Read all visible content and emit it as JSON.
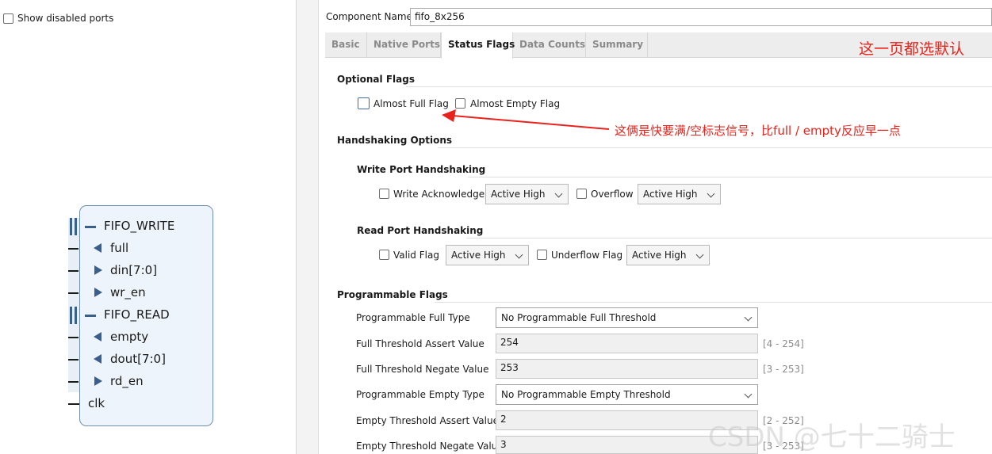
{
  "left": {
    "show_disabled_ports": "Show disabled ports"
  },
  "symbol": {
    "fifo_write": "FIFO_WRITE",
    "full": "full",
    "din": "din[7:0]",
    "wr_en": "wr_en",
    "fifo_read": "FIFO_READ",
    "empty": "empty",
    "dout": "dout[7:0]",
    "rd_en": "rd_en",
    "clk": "clk"
  },
  "header": {
    "component_name_label": "Component Name",
    "component_name_value": "fifo_8x256"
  },
  "tabs": [
    "Basic",
    "Native Ports",
    "Status Flags",
    "Data Counts",
    "Summary"
  ],
  "active_tab": "Status Flags",
  "annotations": {
    "page_note": "这一页都选默认",
    "arrow_note": "这俩是快要满/空标志信号，比full / empty反应早一点"
  },
  "optional_flags": {
    "title": "Optional Flags",
    "almost_full": "Almost Full Flag",
    "almost_empty": "Almost Empty Flag"
  },
  "handshaking": {
    "title": "Handshaking Options",
    "write_title": "Write Port Handshaking",
    "write_ack": "Write Acknowledge",
    "write_ack_sel": "Active High",
    "overflow": "Overflow",
    "overflow_sel": "Active High",
    "read_title": "Read Port Handshaking",
    "valid": "Valid Flag",
    "valid_sel": "Active High",
    "underflow": "Underflow Flag",
    "underflow_sel": "Active High"
  },
  "programmable": {
    "title": "Programmable Flags",
    "full_type_label": "Programmable Full Type",
    "full_type_value": "No Programmable Full Threshold",
    "full_assert_label": "Full Threshold Assert Value",
    "full_assert_value": "254",
    "full_assert_range": "[4 - 254]",
    "full_negate_label": "Full Threshold Negate Value",
    "full_negate_value": "253",
    "full_negate_range": "[3 - 253]",
    "empty_type_label": "Programmable Empty Type",
    "empty_type_value": "No Programmable Empty Threshold",
    "empty_assert_label": "Empty Threshold Assert Value",
    "empty_assert_value": "2",
    "empty_assert_range": "[2 - 252]",
    "empty_negate_label": "Empty Threshold Negate Value",
    "empty_negate_value": "3",
    "empty_negate_range": "[3 - 253]"
  },
  "watermark": "CSDN @七十二骑士",
  "colors": {
    "annotation_red": "#e8231b",
    "symbol_blue": "#3b5f8c",
    "symbol_fill": "#eef4fb"
  }
}
